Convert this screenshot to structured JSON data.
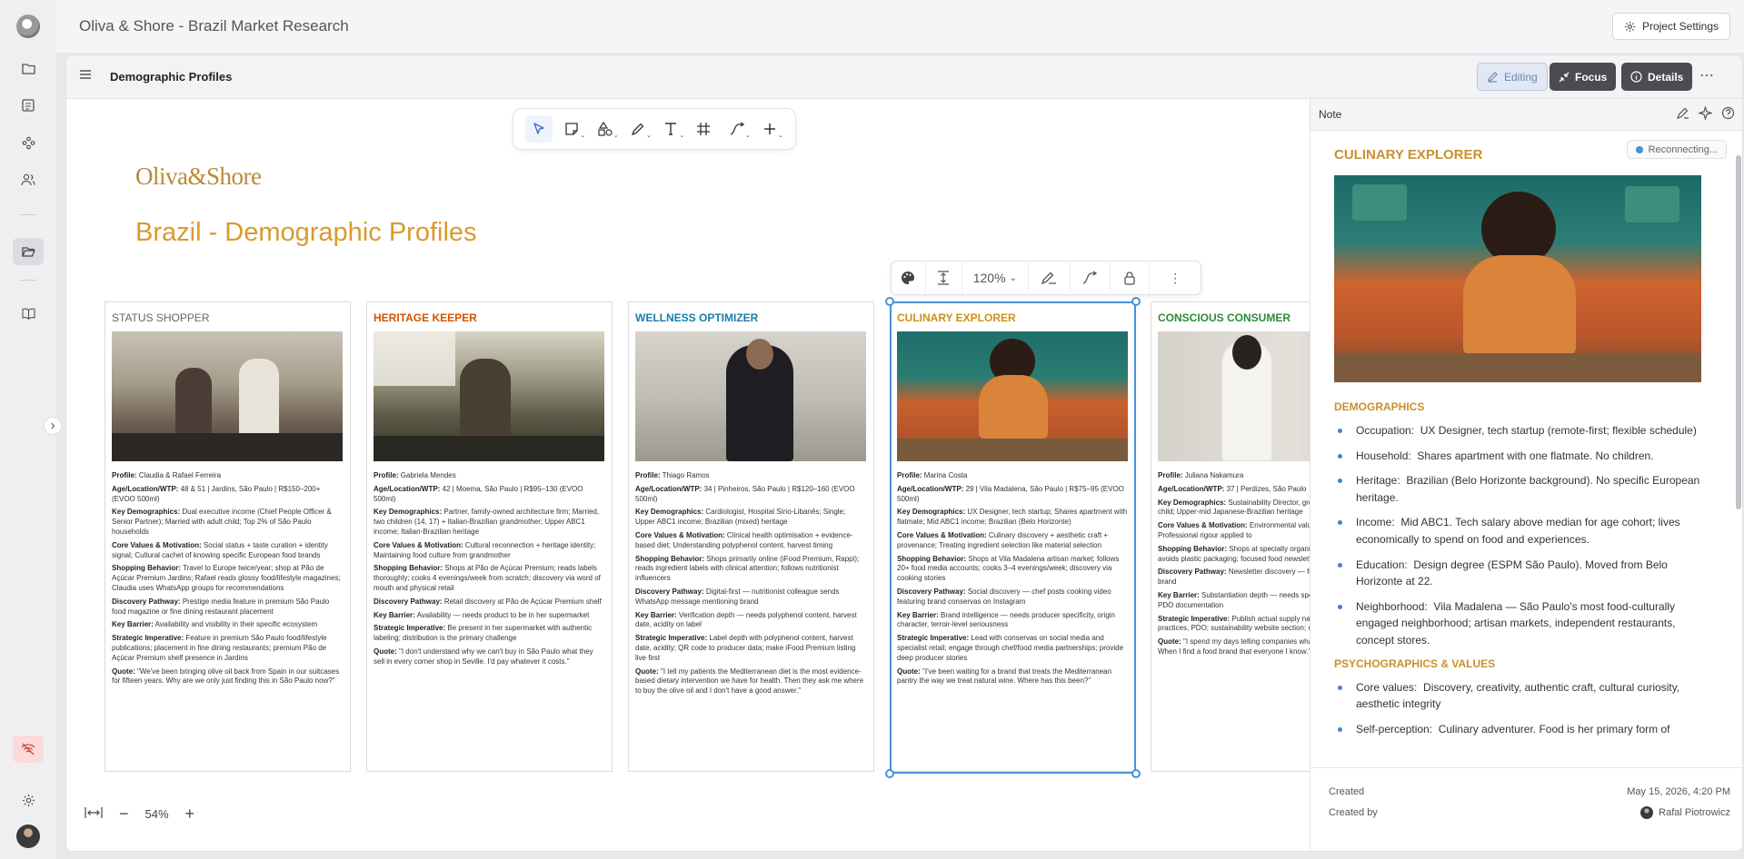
{
  "app": {
    "title": "Oliva & Shore - Brazil Market Research",
    "project_settings_label": "Project Settings"
  },
  "panel": {
    "title": "Demographic Profiles",
    "editing_label": "Editing",
    "focus_label": "Focus",
    "details_label": "Details"
  },
  "canvas": {
    "logo_text": "Oliva&Shore",
    "heading": "Brazil - Demographic Profiles",
    "object_zoom": "120%",
    "view_zoom": "54%"
  },
  "colors": {
    "accent_gold": "#d99a2e",
    "selection_blue": "#4a90d9",
    "status_gray": "#555555",
    "heritage_orange": "#d35400",
    "wellness_teal": "#1a7ea8",
    "culinary_gold": "#d18e16",
    "conscious_green": "#2e8b3a"
  },
  "cards": [
    {
      "title": "STATUS SHOPPER",
      "profile": "Claudia & Rafael Ferreira",
      "age": "48 & 51 | Jardins, São Paulo | R$150–200+ (EVOO 500ml)",
      "demo": "Dual executive income (Chief People Officer & Senior Partner); Married with adult child; Top 2% of São Paulo households",
      "values": "Social status + taste curation + identity signal; Cultural cachet of knowing specific European food brands",
      "shopping": "Travel to Europe twice/year; shop at Pão de Açúcar Premium Jardins; Rafael reads glossy food/lifestyle magazines; Claudia uses WhatsApp groups for recommendations",
      "discovery": "Prestige media feature in premium São Paulo food magazine or fine dining restaurant placement",
      "barrier": "Availability and visibility in their specific ecosystem",
      "strategic": "Feature in premium São Paulo food/lifestyle publications; placement in fine dining restaurants; premium Pão de Açúcar Premium shelf presence in Jardins",
      "quote": "\"We've been bringing olive oil back from Spain in our suitcases for fifteen years. Why are we only just finding this in São Paulo now?\""
    },
    {
      "title": "HERITAGE KEEPER",
      "profile": "Gabriela Mendes",
      "age": "42 | Moema, São Paulo | R$95–130 (EVOO 500ml)",
      "demo": "Partner, family-owned architecture firm; Married, two children (14, 17) + Italian-Brazilian grandmother; Upper ABC1 income; Italian-Brazilian heritage",
      "values": "Cultural reconnection + heritage identity; Maintaining food culture from grandmother",
      "shopping": "Shops at Pão de Açúcar Premium; reads labels thoroughly; cooks 4 evenings/week from scratch; discovery via word of mouth and physical retail",
      "discovery": "Retail discovery at Pão de Açúcar Premium shelf",
      "barrier": "Availability — needs product to be in her supermarket",
      "strategic": "Be present in her supermarket with authentic labeling; distribution is the primary challenge",
      "quote": "\"I don't understand why we can't buy in São Paulo what they sell in every corner shop in Seville. I'd pay whatever it costs.\""
    },
    {
      "title": "WELLNESS OPTIMIZER",
      "profile": "Thiago Ramos",
      "age": "34 | Pinheiros, São Paulo | R$120–160 (EVOO 500ml)",
      "demo": "Cardiologist, Hospital Sírio-Libanês; Single; Upper ABC1 income; Brazilian (mixed) heritage",
      "values": "Clinical health optimisation + evidence-based diet; Understanding polyphenol content, harvest timing",
      "shopping": "Shops primarily online (iFood Premium, Rappi); reads ingredient labels with clinical attention; follows nutritionist influencers",
      "discovery": "Digital-first — nutritionist colleague sends WhatsApp message mentioning brand",
      "barrier": "Verification depth — needs polyphenol content, harvest date, acidity on label",
      "strategic": "Label depth with polyphenol content, harvest date, acidity; QR code to producer data; make iFood Premium listing live first",
      "quote": "\"I tell my patients the Mediterranean diet is the most evidence-based dietary intervention we have for health. Then they ask me where to buy the olive oil and I don't have a good answer.\""
    },
    {
      "title": "CULINARY EXPLORER",
      "profile": "Marina Costa",
      "age": "29 | Vila Madalena, São Paulo | R$75–95 (EVOO 500ml)",
      "demo": "UX Designer, tech startup; Shares apartment with flatmate; Mid ABC1 income; Brazilian (Belo Horizonte)",
      "values": "Culinary discovery + aesthetic craft + provenance; Treating ingredient selection like material selection",
      "shopping": "Shops at Vila Madalena artisan market; follows 20+ food media accounts; cooks 3–4 evenings/week; discovery via cooking stories",
      "discovery": "Social discovery — chef posts cooking video featuring brand conservas on Instagram",
      "barrier": "Brand intelligence — needs producer specificity, origin character, terroir-level seriousness",
      "strategic": "Lead with conservas on social media and specialist retail; engage through chef/food media partnerships; provide deep producer stories",
      "quote": "\"I've been waiting for a brand that treats the Mediterranean pantry the way we treat natural wine. Where has this been?\""
    },
    {
      "title": "CONSCIOUS CONSUMER",
      "profile": "Juliana Nakamura",
      "age": "37 | Perdizes, São Paulo",
      "demo": "Sustainability Director, group; Married with young child; Upper-mid Japanese-Brazilian heritage",
      "values": "Environmental values; transparency; Professional rigour applied to",
      "shopping": "Shops at specialty organic; researches brands; avoids plastic packaging; focused food newsletter",
      "discovery": "Newsletter discovery — food media profile of brand",
      "barrier": "Substantiation depth — needs specific farming practices, PDO documentation",
      "strategic": "Publish actual supply named producers, farming practices, PDO; sustainability website section; responsive e",
      "quote": "\"I spend my days telling companies what a story looks like. When I find a food brand that everyone I know.\""
    }
  ],
  "card_labels": {
    "profile": "Profile:",
    "age": "Age/Location/WTP:",
    "demo": "Key Demographics:",
    "values": "Core Values & Motivation:",
    "shopping": "Shopping Behavior:",
    "discovery": "Discovery Pathway:",
    "barrier": "Key Barrier:",
    "strategic": "Strategic Imperative:",
    "quote": "Quote:"
  },
  "note": {
    "label": "Note",
    "status": "Reconnecting...",
    "title": "CULINARY EXPLORER",
    "demographics_heading": "DEMOGRAPHICS",
    "demographics": [
      {
        "key": "Occupation:",
        "value": "UX Designer, tech startup (remote-first; flexible schedule)"
      },
      {
        "key": "Household:",
        "value": "Shares apartment with one flatmate. No children."
      },
      {
        "key": "Heritage:",
        "value": "Brazilian (Belo Horizonte background). No specific European heritage."
      },
      {
        "key": "Income:",
        "value": "Mid ABC1. Tech salary above median for age cohort; lives economically to spend on food and experiences."
      },
      {
        "key": "Education:",
        "value": "Design degree (ESPM São Paulo). Moved from Belo Horizonte at 22."
      },
      {
        "key": "Neighborhood:",
        "value": "Vila Madalena — São Paulo's most food-culturally engaged neighborhood; artisan markets, independent restaurants, concept stores."
      }
    ],
    "psychographics_heading": "PSYCHOGRAPHICS & VALUES",
    "psychographics": [
      {
        "key": "Core values:",
        "value": "Discovery, creativity, authentic craft, cultural curiosity, aesthetic integrity"
      },
      {
        "key": "Self-perception:",
        "value": "Culinary adventurer. Food is her primary form of"
      }
    ],
    "created_label": "Created",
    "created_value": "May 15, 2026, 4:20 PM",
    "created_by_label": "Created by",
    "created_by_value": "Rafal Piotrowicz"
  }
}
